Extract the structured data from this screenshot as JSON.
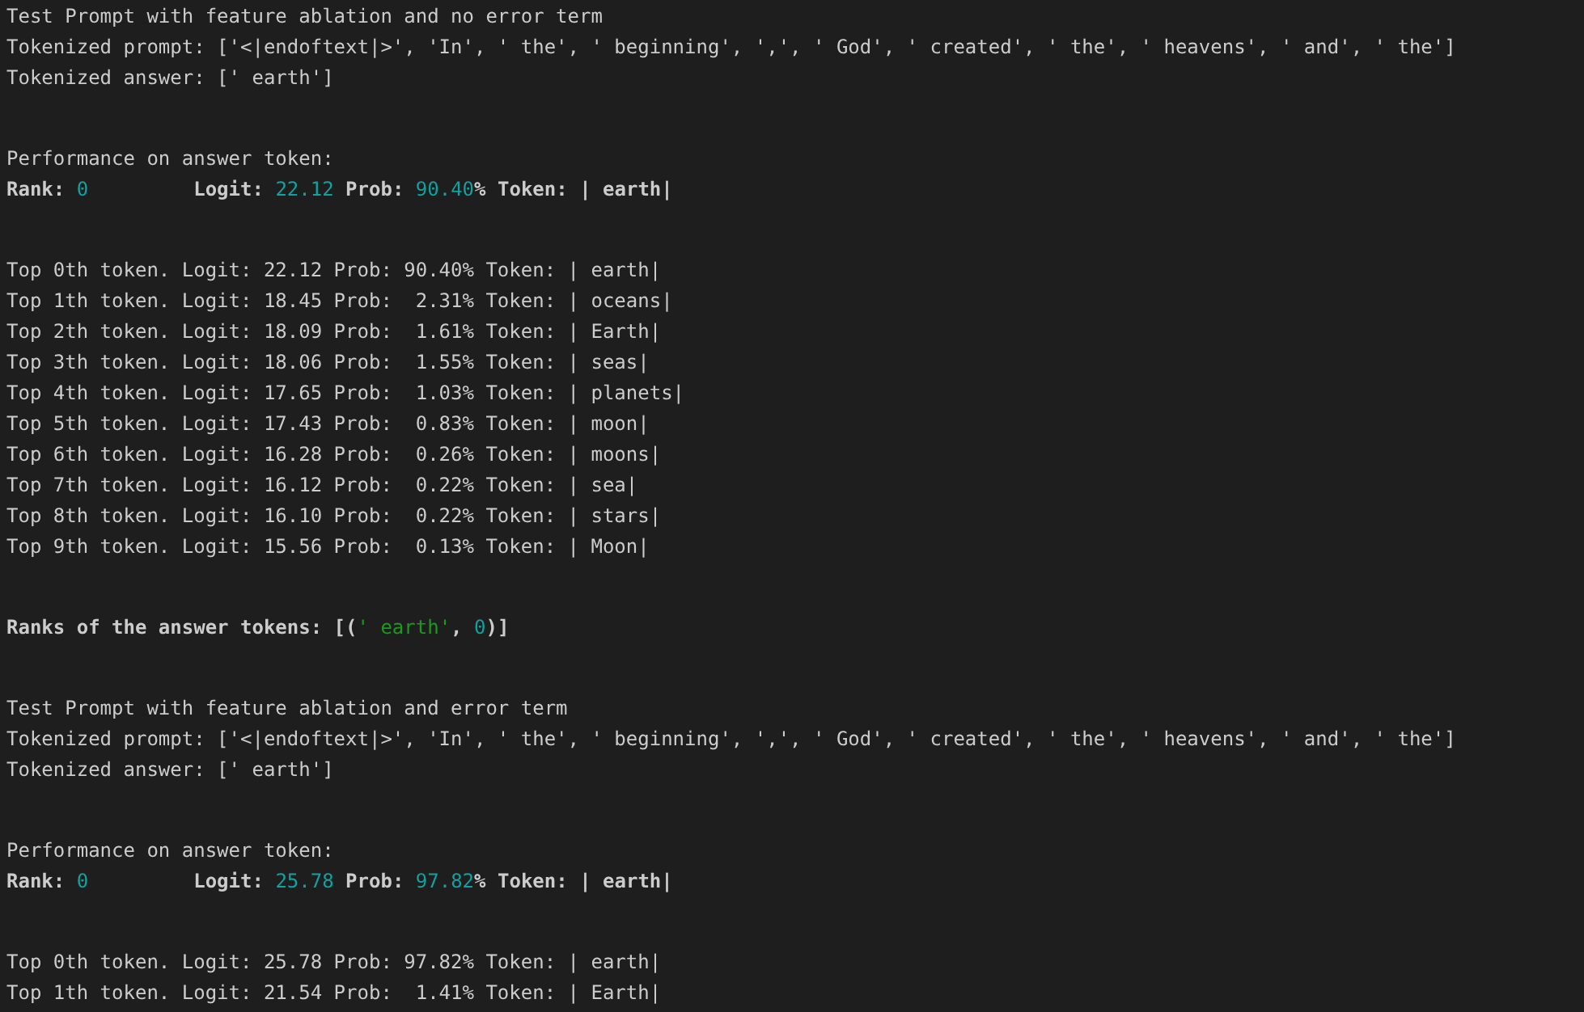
{
  "output_blocks": [
    {
      "lines": [
        {
          "kind": "text",
          "text": "Test Prompt with feature ablation and no error term"
        },
        {
          "kind": "text",
          "text": "Tokenized prompt: ['<|endoftext|>', 'In', ' the', ' beginning', ',', ' God', ' created', ' the', ' heavens', ' and', ' the']"
        },
        {
          "kind": "text",
          "text": "Tokenized answer: [' earth']"
        }
      ]
    },
    {
      "lines": [
        {
          "kind": "text",
          "text": "Performance on answer token:"
        },
        {
          "kind": "performance",
          "rank_label": "Rank:",
          "rank": "0",
          "logit_label": "Logit:",
          "logit": "22.12",
          "prob_label": "Prob:",
          "prob": "90.40",
          "percent": "%",
          "token": "Token: | earth|"
        }
      ]
    },
    {
      "lines": [
        {
          "kind": "text",
          "text": "Top 0th token. Logit: 22.12 Prob: 90.40% Token: | earth|"
        },
        {
          "kind": "text",
          "text": "Top 1th token. Logit: 18.45 Prob:  2.31% Token: | oceans|"
        },
        {
          "kind": "text",
          "text": "Top 2th token. Logit: 18.09 Prob:  1.61% Token: | Earth|"
        },
        {
          "kind": "text",
          "text": "Top 3th token. Logit: 18.06 Prob:  1.55% Token: | seas|"
        },
        {
          "kind": "text",
          "text": "Top 4th token. Logit: 17.65 Prob:  1.03% Token: | planets|"
        },
        {
          "kind": "text",
          "text": "Top 5th token. Logit: 17.43 Prob:  0.83% Token: | moon|"
        },
        {
          "kind": "text",
          "text": "Top 6th token. Logit: 16.28 Prob:  0.26% Token: | moons|"
        },
        {
          "kind": "text",
          "text": "Top 7th token. Logit: 16.12 Prob:  0.22% Token: | sea|"
        },
        {
          "kind": "text",
          "text": "Top 8th token. Logit: 16.10 Prob:  0.22% Token: | stars|"
        },
        {
          "kind": "text",
          "text": "Top 9th token. Logit: 15.56 Prob:  0.13% Token: | Moon|"
        }
      ]
    },
    {
      "lines": [
        {
          "kind": "ranks",
          "label": "Ranks of the answer tokens: [(",
          "token": "' earth'",
          "separator": ", ",
          "rank": "0",
          "end": ")]"
        }
      ]
    },
    {
      "lines": [
        {
          "kind": "text",
          "text": "Test Prompt with feature ablation and error term"
        },
        {
          "kind": "text",
          "text": "Tokenized prompt: ['<|endoftext|>', 'In', ' the', ' beginning', ',', ' God', ' created', ' the', ' heavens', ' and', ' the']"
        },
        {
          "kind": "text",
          "text": "Tokenized answer: [' earth']"
        }
      ]
    },
    {
      "lines": [
        {
          "kind": "text",
          "text": "Performance on answer token:"
        },
        {
          "kind": "performance",
          "rank_label": "Rank:",
          "rank": "0",
          "logit_label": "Logit:",
          "logit": "25.78",
          "prob_label": "Prob:",
          "prob": "97.82",
          "percent": "%",
          "token": "Token: | earth|"
        }
      ]
    },
    {
      "lines": [
        {
          "kind": "text",
          "text": "Top 0th token. Logit: 25.78 Prob: 97.82% Token: | earth|"
        },
        {
          "kind": "text",
          "text": "Top 1th token. Logit: 21.54 Prob:  1.41% Token: | Earth|"
        }
      ]
    }
  ]
}
